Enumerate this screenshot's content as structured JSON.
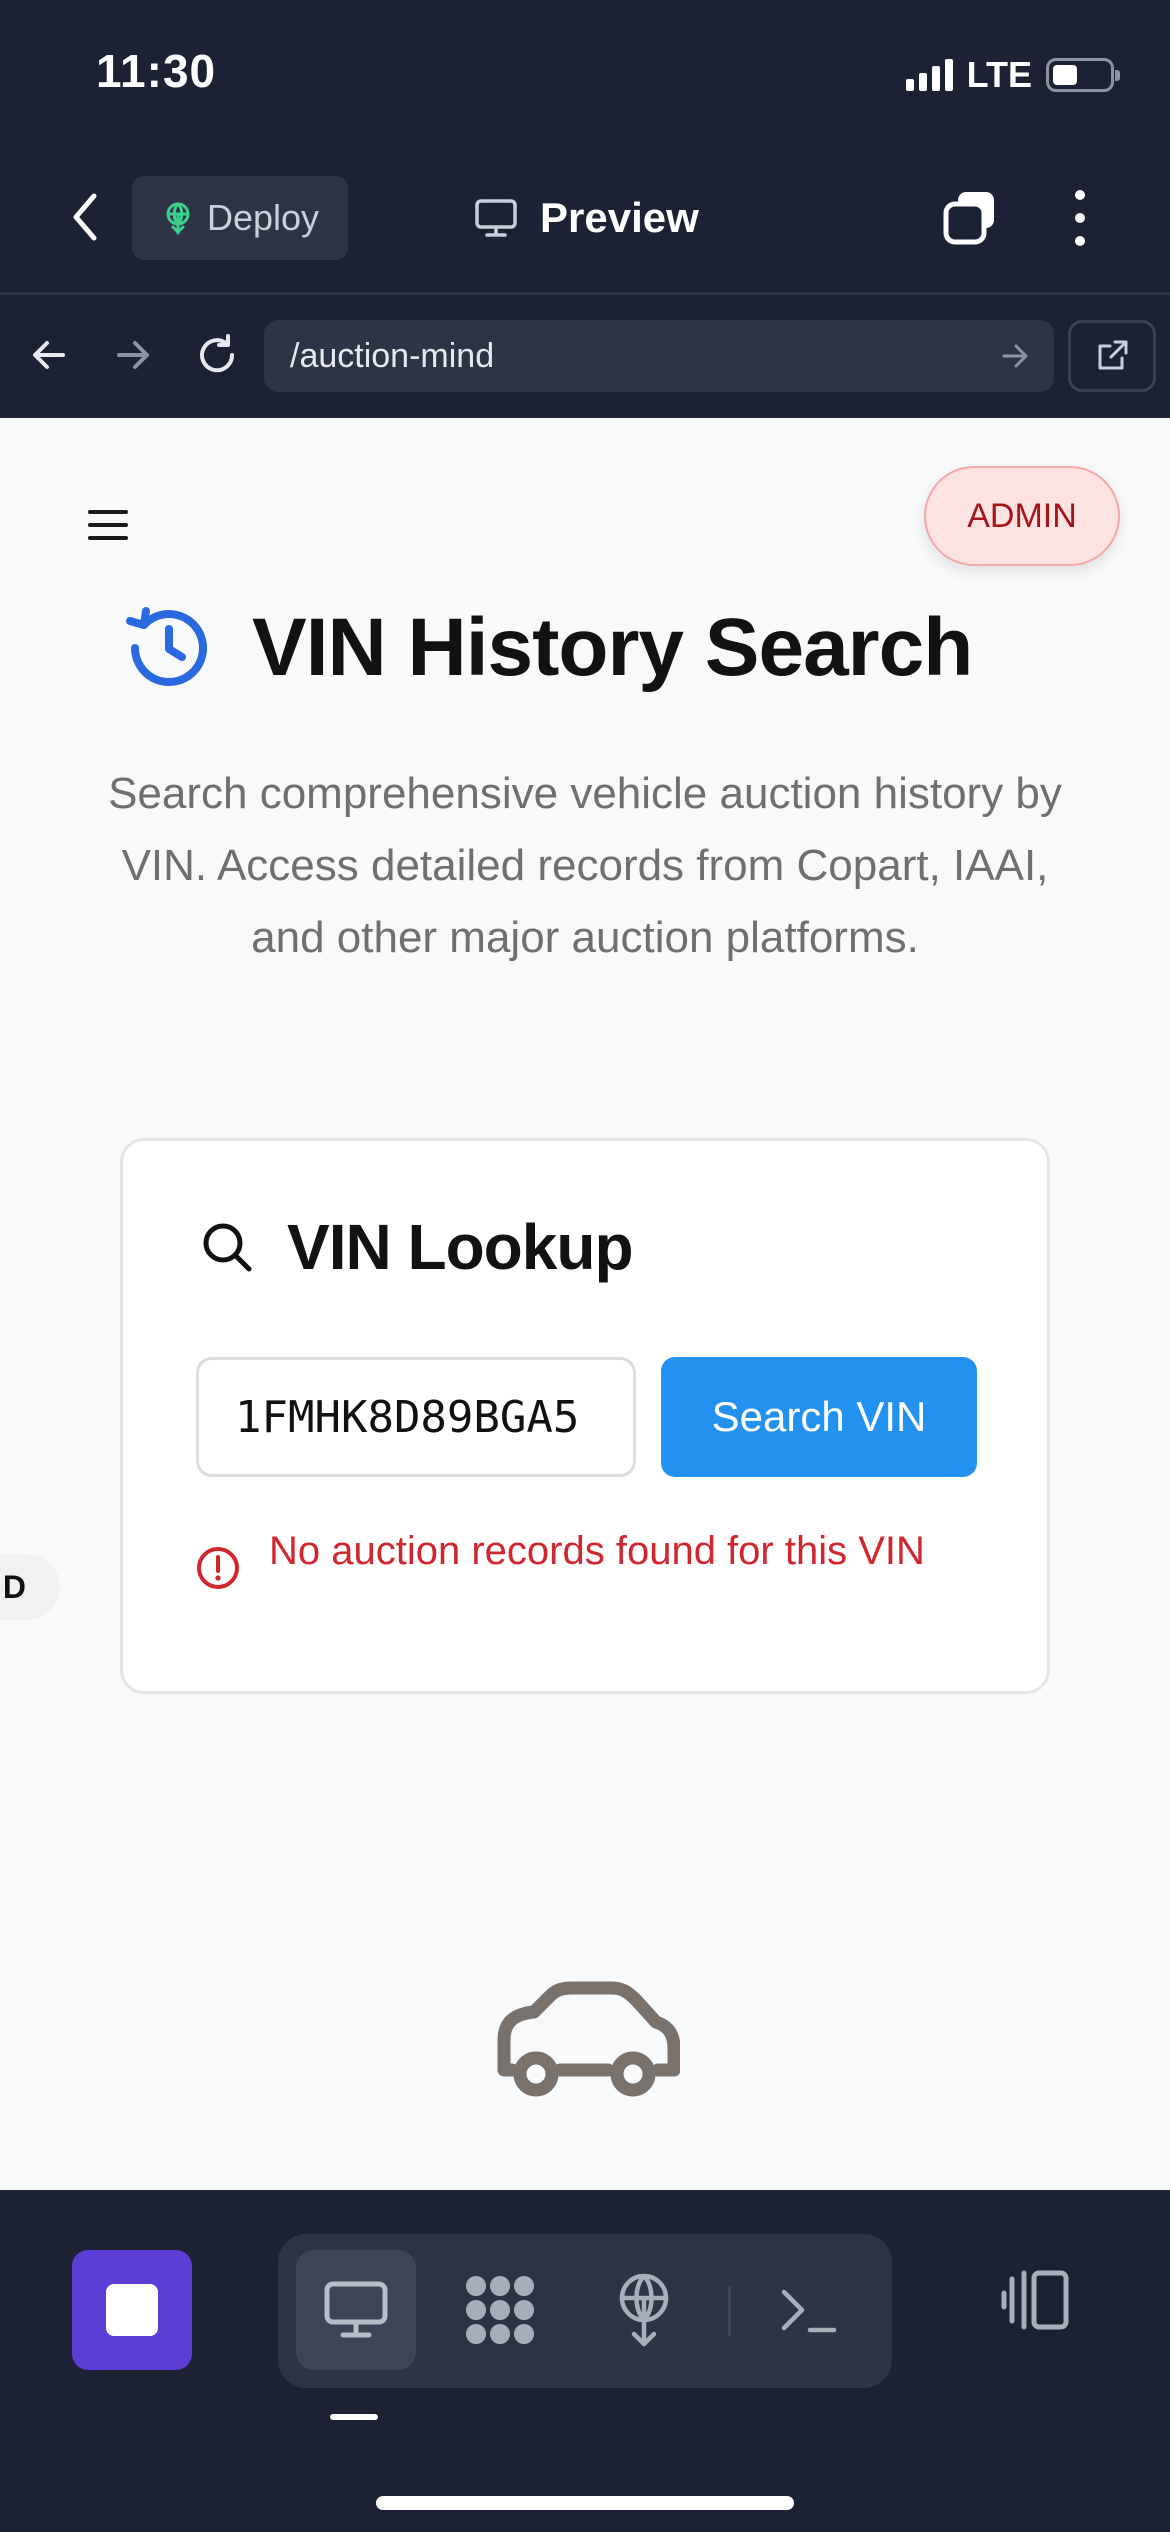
{
  "status_bar": {
    "time": "11:30",
    "network": "LTE",
    "battery_level": 0.3
  },
  "toolbar": {
    "back_icon": "chevron-left-icon",
    "deploy_label": "Deploy",
    "preview_label": "Preview",
    "tabs_icon": "tabs-icon",
    "more_icon": "more-vertical-icon"
  },
  "browser": {
    "url": "/auction-mind",
    "back_icon": "arrow-left-icon",
    "forward_icon": "arrow-right-icon",
    "reload_icon": "reload-icon",
    "external_icon": "external-link-icon"
  },
  "page": {
    "admin_badge": "ADMIN",
    "title": "VIN History Search",
    "description": "Search comprehensive vehicle auction history by VIN. Access detailed records from Copart, IAAI, and other major auction platforms.",
    "lookup": {
      "title": "VIN Lookup",
      "vin_value": "1FMHK8D89BGA5",
      "search_button": "Search VIN",
      "error_message": "No auction records found for this VIN"
    },
    "side_chip": "D"
  },
  "bottom_bar": {
    "stop_icon": "stop-icon",
    "tools": [
      "monitor-icon",
      "apps-icon",
      "deploy-icon",
      "terminal-icon"
    ],
    "panel_icon": "panel-toggle-icon"
  },
  "colors": {
    "background_dark": "#1c2233",
    "accent_blue": "#2291f0",
    "error_red": "#d0262e",
    "stop_purple": "#5c3ed6",
    "history_icon_blue": "#2a69e0"
  }
}
